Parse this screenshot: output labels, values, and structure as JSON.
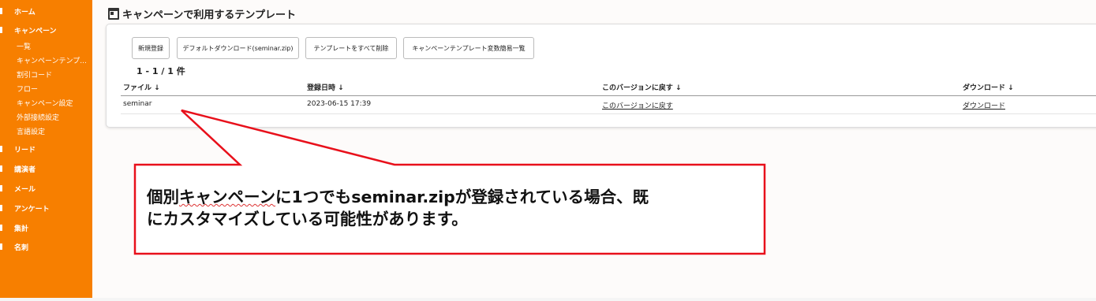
{
  "sidebar": {
    "items": [
      {
        "label": "ホーム"
      },
      {
        "label": "キャンペーン"
      },
      {
        "label": "リード"
      },
      {
        "label": "講演者"
      },
      {
        "label": "メール"
      },
      {
        "label": "アンケート"
      },
      {
        "label": "集計"
      },
      {
        "label": "名刺"
      }
    ],
    "campaign_subitems": [
      {
        "label": "一覧"
      },
      {
        "label": "キャンペーンテンプ..."
      },
      {
        "label": "割引コード"
      },
      {
        "label": "フロー"
      },
      {
        "label": "キャンペーン設定"
      },
      {
        "label": "外部接続設定"
      },
      {
        "label": "言語設定"
      }
    ]
  },
  "page": {
    "title": "キャンペーンで利用するテンプレート"
  },
  "toolbar": {
    "new_label": "新規登録",
    "download_default_label": "デフォルトダウンロード(seminar.zip)",
    "delete_all_label": "テンプレートをすべて削除",
    "variables_label": "キャンペーンテンプレート変数簡易一覧"
  },
  "pagination": {
    "count_text": "1 - 1 / 1 件"
  },
  "table": {
    "columns": [
      "ファイル ↓",
      "登録日時 ↓",
      "このバージョンに戻す ↓",
      "ダウンロード ↓"
    ],
    "rows": [
      {
        "file": "seminar",
        "registered_at": "2023-06-15 17:39",
        "revert": "このバージョンに戻す",
        "download": "ダウンロード"
      }
    ]
  },
  "annotation": {
    "line1_pre": "個別",
    "line1_squiggle": "キャンペーン",
    "line1_post": "に1つでもseminar.zipが登録されている場合、既",
    "line2": "にカスタマイズしている可能性があります。",
    "color": "#e8101b"
  },
  "colors": {
    "sidebar_bg": "#f77f00",
    "main_bg": "#fdfbfa"
  }
}
